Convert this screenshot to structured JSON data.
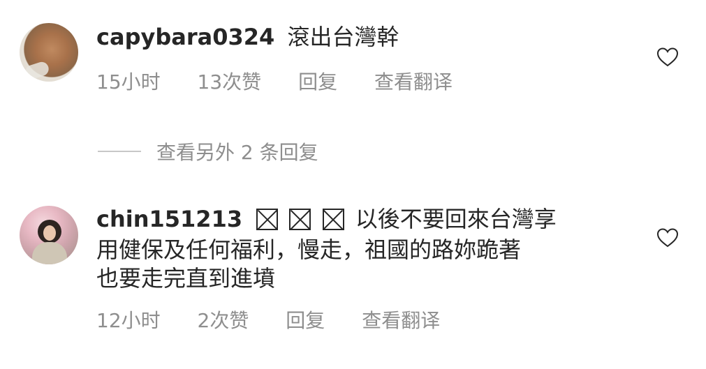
{
  "comments": [
    {
      "username": "capybara0324",
      "text": "滾出台灣幹",
      "time": "15小时",
      "likes": "13次赞",
      "reply": "回复",
      "translate": "查看翻译",
      "avatar_icon": "capybara-avatar"
    },
    {
      "username": "chin151213",
      "boxed_glyphs": [
        "☒",
        "☒",
        "☒"
      ],
      "text_line1": "以後不要回來台灣享",
      "text_line2": "用健保及任何福利，慢走，祖國的路妳跪著",
      "text_line3": "也要走完直到進墳",
      "time": "12小时",
      "likes": "2次赞",
      "reply": "回复",
      "translate": "查看翻译",
      "avatar_icon": "user-photo-avatar"
    }
  ],
  "view_more_replies": "查看另外 2 条回复",
  "icons": {
    "like": "heart-icon"
  },
  "colors": {
    "text": "#262626",
    "meta": "#8e8e8e"
  }
}
